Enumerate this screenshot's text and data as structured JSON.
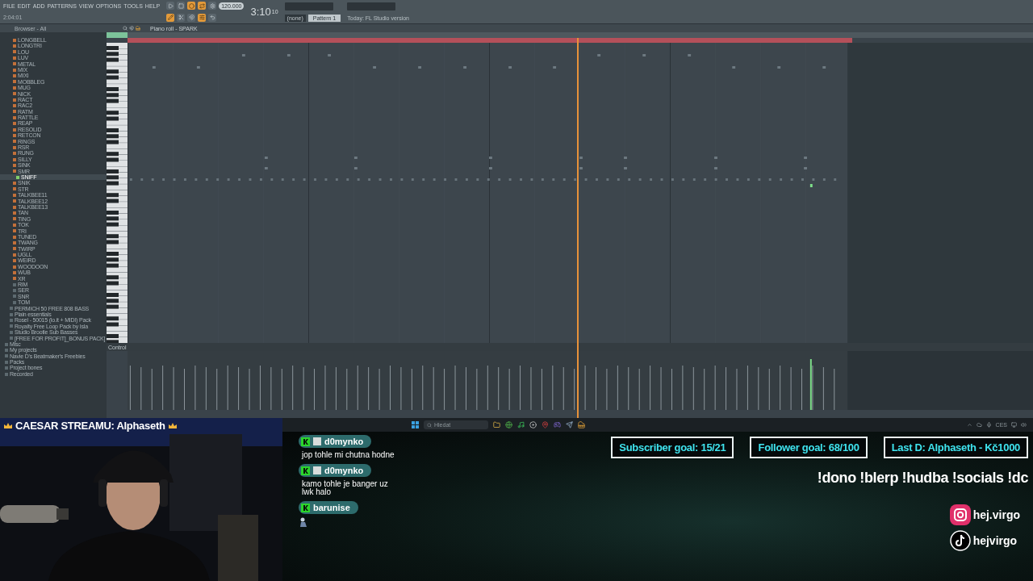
{
  "menu": [
    "FILE",
    "EDIT",
    "ADD",
    "PATTERNS",
    "VIEW",
    "OPTIONS",
    "TOOLS",
    "HELP"
  ],
  "transport": {
    "tempo": "120.000",
    "time": "3:10",
    "time_small": "10",
    "hint_time": "2:04:01",
    "none_label": "(none)",
    "pattern": "Pattern 1",
    "news": "Today: FL Studio version"
  },
  "toolbar_buttons": [
    {
      "selected": false
    },
    {
      "selected": false
    },
    {
      "selected": true
    },
    {
      "selected": true
    },
    {
      "selected": false
    }
  ],
  "toolbar_buttons_2": [
    {
      "selected": true
    },
    {
      "selected": false
    },
    {
      "selected": false
    },
    {
      "selected": true
    },
    {
      "selected": false
    }
  ],
  "browser": {
    "title": "Browser - All",
    "files": [
      {
        "label": "LONGBELL",
        "selected": false
      },
      {
        "label": "LONGTRI",
        "selected": false
      },
      {
        "label": "LOU",
        "selected": false
      },
      {
        "label": "LUV",
        "selected": false
      },
      {
        "label": "METAL",
        "selected": false
      },
      {
        "label": "MIX",
        "selected": false
      },
      {
        "label": "MIXI",
        "selected": false
      },
      {
        "label": "MOBBLEG",
        "selected": false
      },
      {
        "label": "MUG",
        "selected": false
      },
      {
        "label": "NICK",
        "selected": false
      },
      {
        "label": "RACT",
        "selected": false
      },
      {
        "label": "RAC2",
        "selected": false
      },
      {
        "label": "RATM",
        "selected": false
      },
      {
        "label": "RATTLE",
        "selected": false
      },
      {
        "label": "REAP",
        "selected": false
      },
      {
        "label": "RESOLID",
        "selected": false
      },
      {
        "label": "RETCON",
        "selected": false
      },
      {
        "label": "RINGS",
        "selected": false
      },
      {
        "label": "RSR",
        "selected": false
      },
      {
        "label": "RUNG",
        "selected": false
      },
      {
        "label": "SILLY",
        "selected": false
      },
      {
        "label": "SINK",
        "selected": false
      },
      {
        "label": "SMR",
        "selected": false,
        "children": [
          {
            "label": "SNIFF",
            "selected": true
          }
        ]
      },
      {
        "label": "SNIK",
        "selected": false
      },
      {
        "label": "STR",
        "selected": false
      },
      {
        "label": "TALKBEE11",
        "selected": false
      },
      {
        "label": "TALKBEE12",
        "selected": false
      },
      {
        "label": "TALKBEE13",
        "selected": false
      },
      {
        "label": "TAN",
        "selected": false
      },
      {
        "label": "TING",
        "selected": false
      },
      {
        "label": "TOK",
        "selected": false
      },
      {
        "label": "TRI",
        "selected": false
      },
      {
        "label": "TUNED",
        "selected": false
      },
      {
        "label": "TWANG",
        "selected": false
      },
      {
        "label": "TWIRP",
        "selected": false
      },
      {
        "label": "UGLL",
        "selected": false
      },
      {
        "label": "WEIRD",
        "selected": false
      },
      {
        "label": "WOODOON",
        "selected": false
      },
      {
        "label": "WUB",
        "selected": false
      },
      {
        "label": "XR",
        "selected": false
      }
    ],
    "subfolders": [
      "RIM",
      "SER",
      "SNR",
      "TOM"
    ],
    "packs": [
      "PERMICH 50 FREE 808 BASS",
      "Plain essentials",
      "Rosel - 50015 (lo.it + MIDI) Pack",
      "Royalty Free Loop Pack by Isla",
      "Studio Brootle Sub Basses",
      "[FREE FOR PROFIT]_BONUS PACK]"
    ],
    "folders": [
      "Misc",
      "My projects",
      "Navie D's Beatmaker's Freebies",
      "Packs",
      "Project bones",
      "Recorded"
    ]
  },
  "piano_roll": {
    "title": "Piano roll - SPARK",
    "control_label": "Control"
  },
  "webcam": {
    "title": "CAESAR STREAMU: Alphaseth"
  },
  "taskbar": {
    "search_placeholder": "Hledat",
    "tray_text": "CES"
  },
  "chat": [
    {
      "user": "d0mynko",
      "avatar": true,
      "sticker": false,
      "text": "jop tohle mi chutna hodne"
    },
    {
      "user": "d0mynko",
      "avatar": true,
      "sticker": false,
      "text": "kamo tohle je banger uz lwk halo"
    },
    {
      "user": "barunise",
      "avatar": false,
      "sticker": true
    }
  ],
  "goals": [
    "Subscriber goal: 15/21",
    "Follower goal: 68/100",
    "Last D: Alphaseth - Kč1000"
  ],
  "commands": "!dono !blerp !hudba !socials !dc",
  "socials": [
    {
      "kind": "instagram",
      "handle": "hej.virgo"
    },
    {
      "kind": "tiktok",
      "handle": "hejvirgo"
    }
  ]
}
